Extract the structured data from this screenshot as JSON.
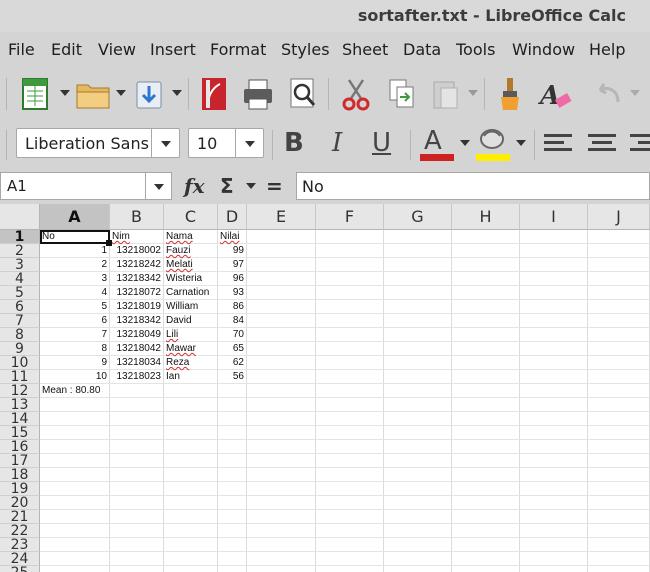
{
  "window": {
    "title": "sortafter.txt - LibreOffice Calc"
  },
  "menu": [
    "File",
    "Edit",
    "View",
    "Insert",
    "Format",
    "Styles",
    "Sheet",
    "Data",
    "Tools",
    "Window",
    "Help"
  ],
  "toolbar": {
    "font_name": "Liberation Sans",
    "font_size": "10",
    "bold": "B",
    "italic": "I",
    "underline": "U",
    "font_color_glyph": "A",
    "font_color": "#cc2222",
    "highlight_color": "#ffee00"
  },
  "formula_bar": {
    "name_box": "A1",
    "fx": "fx",
    "sum": "Σ",
    "equals": "=",
    "content": "No"
  },
  "columns": [
    "A",
    "B",
    "C",
    "D",
    "E",
    "F",
    "G",
    "H",
    "I",
    "J"
  ],
  "rows": [
    "1",
    "2",
    "3",
    "4",
    "5",
    "6",
    "7",
    "8",
    "9",
    "10",
    "11",
    "12",
    "13",
    "14",
    "15",
    "16",
    "17",
    "18",
    "19",
    "20",
    "21",
    "22",
    "23",
    "24",
    "25"
  ],
  "sheet": {
    "header": {
      "no": "No",
      "nim": "Nim",
      "nama": "Nama",
      "nilai": "Nilai"
    },
    "records": [
      {
        "no": "1",
        "nim": "13218002",
        "nama": "Fauzi",
        "nilai": "99"
      },
      {
        "no": "2",
        "nim": "13218242",
        "nama": "Melati",
        "nilai": "97"
      },
      {
        "no": "3",
        "nim": "13218342",
        "nama": "Wisteria",
        "nilai": "96"
      },
      {
        "no": "4",
        "nim": "13218072",
        "nama": "Carnation",
        "nilai": "93"
      },
      {
        "no": "5",
        "nim": "13218019",
        "nama": "William",
        "nilai": "86"
      },
      {
        "no": "6",
        "nim": "13218342",
        "nama": "David",
        "nilai": "84"
      },
      {
        "no": "7",
        "nim": "13218049",
        "nama": "Lili",
        "nilai": "70"
      },
      {
        "no": "8",
        "nim": "13218042",
        "nama": "Mawar",
        "nilai": "65"
      },
      {
        "no": "9",
        "nim": "13218034",
        "nama": "Reza",
        "nilai": "62"
      },
      {
        "no": "10",
        "nim": "13218023",
        "nama": "Ian",
        "nilai": "56"
      }
    ],
    "mean": "Mean : 80.80"
  }
}
